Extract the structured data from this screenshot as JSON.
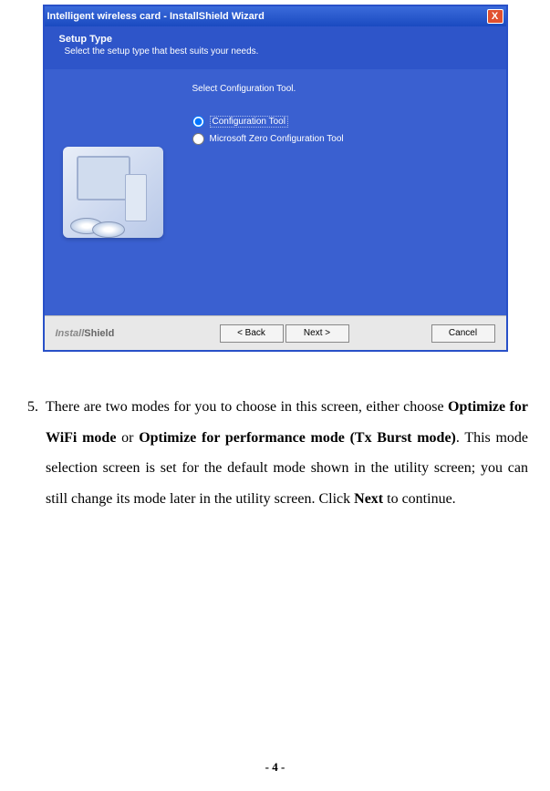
{
  "wizard": {
    "title": "Intelligent wireless card - InstallShield Wizard",
    "close": "X",
    "setup_title": "Setup Type",
    "setup_sub": "Select the setup type that best suits your needs.",
    "select_label": "Select Configuration Tool.",
    "option1": "Configuration Tool",
    "option2": "Microsoft Zero Configuration Tool",
    "install_text": "Install",
    "shield_text": "Shield",
    "back": "< Back",
    "next": "Next >",
    "cancel": "Cancel"
  },
  "body": {
    "num": "5.",
    "t1": "There are two modes for you to choose in this screen, either choose ",
    "b1": "Optimize for WiFi mode",
    "t2": " or ",
    "b2": "Optimize for performance mode (Tx Burst mode)",
    "t3": ". This mode selection screen is set for the default mode shown in the utility screen; you can still change its mode later in the utility screen. Click ",
    "b3": "Next",
    "t4": " to continue."
  },
  "page_num": "- 4 -"
}
